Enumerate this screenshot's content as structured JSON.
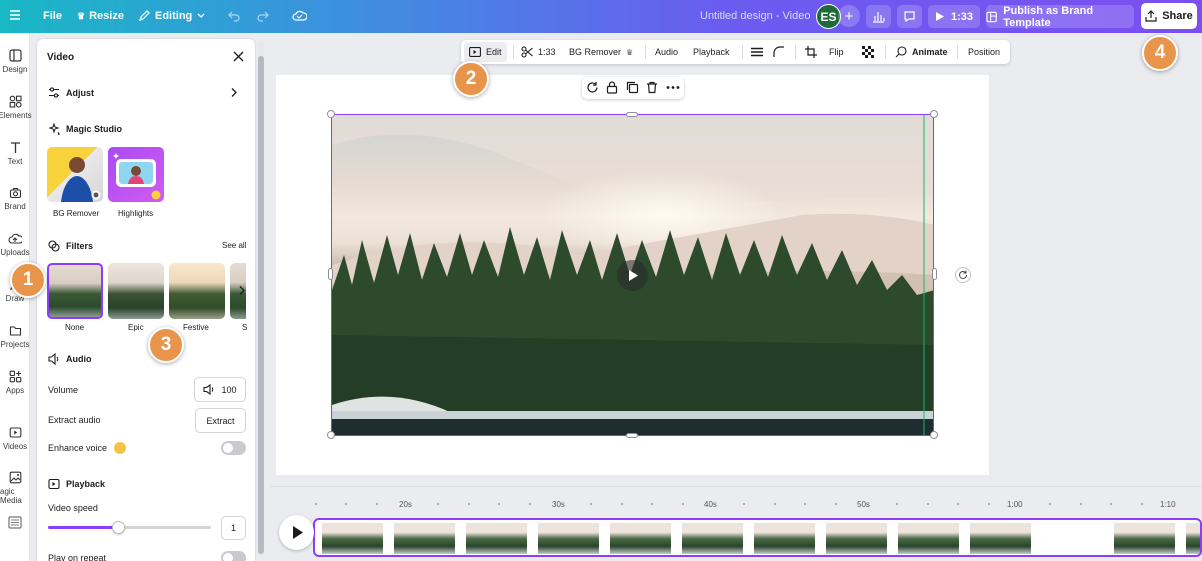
{
  "topbar": {
    "file": "File",
    "resize": "Resize",
    "mode": "Editing",
    "title": "Untitled design - Video",
    "avatar": "ES",
    "duration": "1:33",
    "publish": "Publish as Brand Template",
    "share": "Share"
  },
  "rail": [
    "Design",
    "Elements",
    "Text",
    "Brand",
    "Uploads",
    "Draw",
    "Projects",
    "Apps",
    "Videos",
    "agic Media"
  ],
  "panel": {
    "title": "Video",
    "adjust": "Adjust",
    "magic_studio": "Magic Studio",
    "magic_items": [
      "BG Remover",
      "Highlights"
    ],
    "filters": "Filters",
    "see_all": "See all",
    "filter_items": [
      "None",
      "Epic",
      "Festive",
      "S"
    ],
    "audio": "Audio",
    "volume_label": "Volume",
    "volume_value": "100",
    "extract_label": "Extract audio",
    "extract_btn": "Extract",
    "enhance_label": "Enhance voice",
    "playback": "Playback",
    "speed_label": "Video speed",
    "speed_value": "1",
    "repeat_label": "Play on repeat"
  },
  "ctx": {
    "edit": "Edit",
    "duration": "1:33",
    "bg_remover": "BG Remover",
    "audio": "Audio",
    "playback": "Playback",
    "flip": "Flip",
    "animate": "Animate",
    "position": "Position"
  },
  "timeline": {
    "ticks": [
      "20s",
      "30s",
      "40s",
      "50s",
      "1:00",
      "1:10"
    ]
  },
  "badges": [
    "1",
    "2",
    "3",
    "4"
  ],
  "colors": {
    "accent": "#8b3dff",
    "badge": "#e8944a"
  }
}
